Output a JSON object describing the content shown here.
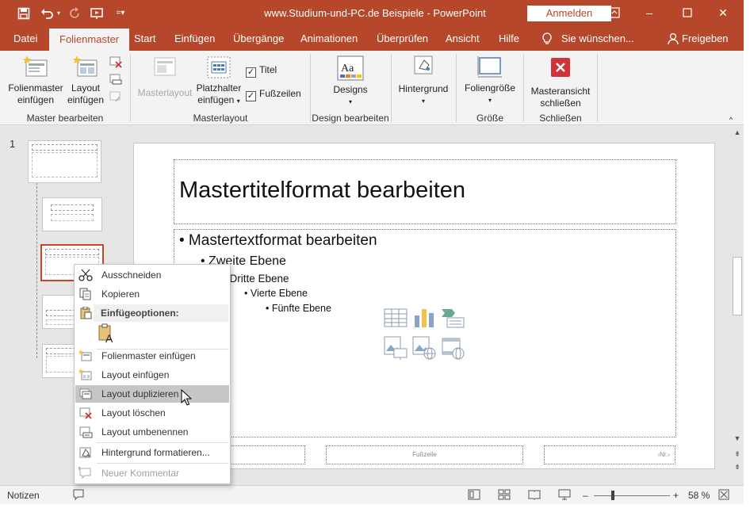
{
  "window": {
    "title": "www.Studium-und-PC.de  Beispiele  -  PowerPoint",
    "signin_label": "Anmelden",
    "accent_color": "#b7472a"
  },
  "quick_access": [
    "save-icon",
    "undo-icon",
    "redo-icon",
    "present-icon",
    "customize-icon"
  ],
  "tabs": {
    "file": "Datei",
    "slide_master": "Folienmaster",
    "home": "Start",
    "insert": "Einfügen",
    "transitions": "Übergänge",
    "animations": "Animationen",
    "review": "Überprüfen",
    "view": "Ansicht",
    "help": "Hilfe",
    "tell_me": "Sie wünschen...",
    "share": "Freigeben"
  },
  "ribbon": {
    "insert_master_l1": "Folienmaster",
    "insert_master_l2": "einfügen",
    "insert_layout_l1": "Layout",
    "insert_layout_l2": "einfügen",
    "group_edit_master": "Master bearbeiten",
    "master_layout": "Masterlayout",
    "placeholder_l1": "Platzhalter",
    "placeholder_l2": "einfügen",
    "title_check": "Titel",
    "footer_check": "Fußzeilen",
    "group_master_layout": "Masterlayout",
    "designs": "Designs",
    "group_edit_design": "Design bearbeiten",
    "background": "Hintergrund",
    "slide_size": "Foliengröße",
    "group_size": "Größe",
    "close_l1": "Masteransicht",
    "close_l2": "schließen",
    "group_close": "Schließen"
  },
  "thumbnails": {
    "slide_number": "1",
    "selected_index": 2
  },
  "slide": {
    "title_placeholder": "Mastertitelformat bearbeiten",
    "levels": [
      "• Mastertextformat bearbeiten",
      "• Zweite Ebene",
      "• Dritte Ebene",
      "• Vierte Ebene",
      "• Fünfte Ebene"
    ],
    "footer_text": "Fußzeile",
    "number_text": "‹Nr.›",
    "insert_icons": [
      "table-icon",
      "chart-icon",
      "smartart-icon",
      "picture-icon",
      "online-picture-icon",
      "video-icon"
    ]
  },
  "context_menu": {
    "cut": "Ausschneiden",
    "copy": "Kopieren",
    "paste_header": "Einfügeoptionen:",
    "insert_master": "Folienmaster einfügen",
    "insert_layout": "Layout einfügen",
    "duplicate_layout": "Layout duplizieren",
    "delete_layout": "Layout löschen",
    "rename_layout": "Layout umbenennen",
    "format_background": "Hintergrund formatieren...",
    "new_comment": "Neuer Kommentar"
  },
  "statusbar": {
    "notes": "Notizen",
    "zoom": "58 %"
  }
}
